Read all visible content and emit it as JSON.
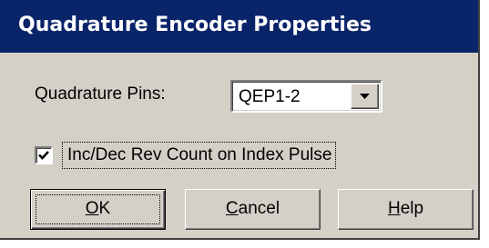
{
  "window": {
    "title": "Quadrature Encoder Properties"
  },
  "pins": {
    "label": "Quadrature Pins:",
    "selected": "QEP1-2"
  },
  "index_option": {
    "label": "Inc/Dec Rev Count on Index Pulse",
    "checked": true
  },
  "buttons": {
    "ok": {
      "mnemonic": "O",
      "rest": "K"
    },
    "cancel": {
      "mnemonic": "C",
      "rest": "ancel"
    },
    "help": {
      "mnemonic": "H",
      "rest": "elp"
    }
  },
  "colors": {
    "titlebar": "#0a246a",
    "face": "#d4d0c8"
  },
  "icons": {
    "dropdown": "chevron-down-icon",
    "check": "checkmark-icon"
  }
}
